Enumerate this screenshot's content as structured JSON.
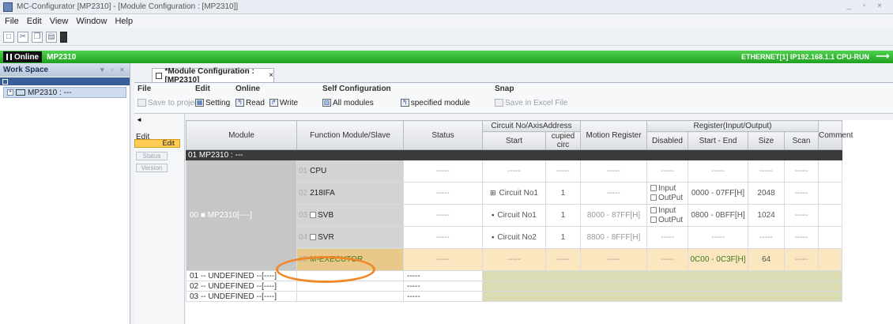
{
  "window": {
    "title": "MC-Configurator [MP2310] - [Module Configuration : [MP2310]]",
    "controls": "_ ▫ ×"
  },
  "menu": [
    "File",
    "Edit",
    "View",
    "Window",
    "Help"
  ],
  "status": {
    "mode": "Online",
    "model": "MP2310",
    "connection": "ETHERNET[1] IP192.168.1.1 CPU-RUN"
  },
  "workspace": {
    "title": "Work Space",
    "controls": "▾ ▫ ×",
    "node": "MP2310 : ---"
  },
  "tab": {
    "label": "*Module Configuration : [MP2310]",
    "close": "×"
  },
  "ribbon": {
    "file": {
      "title": "File",
      "save": "Save to project"
    },
    "edit": {
      "title": "Edit",
      "setting": "Setting"
    },
    "online": {
      "title": "Online",
      "read": "Read",
      "write": "Write"
    },
    "self_config": {
      "title": "Self Configuration",
      "all": "All modules",
      "specified": "specified module"
    },
    "snap": {
      "title": "Snap",
      "save_excel": "Save in Excel File"
    }
  },
  "leftpane": {
    "collapse": "◄",
    "edit_label": "Edit",
    "edit_btn": "Edit",
    "status_btn": "Status",
    "version_btn": "Version"
  },
  "headers": {
    "module": "Module",
    "function": "Function Module/Slave",
    "status": "Status",
    "circuit": "Circuit No/AxisAddress",
    "start": "Start",
    "occupied": "cupied circ",
    "motion": "Motion Register",
    "register": "Register(Input/Output)",
    "disabled": "Disabled",
    "startend": "Start - End",
    "size": "Size",
    "scan": "Scan",
    "comment": "Comment"
  },
  "group": "01 MP2310 : ---",
  "module_cell": "00 ■ MP2310[----]",
  "rows": [
    {
      "slot": "01",
      "func": "CPU",
      "status": "-----",
      "circuit": "-----",
      "occ": "-----",
      "motion": "-----",
      "start_end": "-----",
      "size": "-----",
      "scan": "-----"
    },
    {
      "slot": "02",
      "func": "218IFA",
      "status": "-----",
      "circuit": "Circuit No1",
      "occ": "1",
      "motion": "-----",
      "start_end": "0000 - 07FF[H]",
      "size": "2048",
      "scan": "-----"
    },
    {
      "slot": "03",
      "func": "SVB",
      "status": "-----",
      "circuit": "Circuit No1",
      "occ": "1",
      "motion": "8000 - 87FF[H]",
      "start_end": "0800 - 0BFF[H]",
      "size": "1024",
      "scan": "-----"
    },
    {
      "slot": "04",
      "func": "SVR",
      "status": "-----",
      "circuit": "Circuit No2",
      "occ": "1",
      "motion": "8800 - 8FFF[H]",
      "start_end": "-----",
      "size": "-----",
      "scan": "-----"
    },
    {
      "slot": "05",
      "func": "M-EXECUTOR",
      "status": "-----",
      "circuit": "-----",
      "occ": "-----",
      "motion": "-----",
      "start_end": "0C00 - 0C3F[H]",
      "size": "64",
      "scan": "-----"
    }
  ],
  "io": {
    "input": "Input",
    "output": "OutPut"
  },
  "undefined_rows": [
    "01 -- UNDEFINED --[----]",
    "02 -- UNDEFINED --[----]",
    "03 -- UNDEFINED --[----]"
  ],
  "undefined_status": "-----",
  "dash": "-----"
}
